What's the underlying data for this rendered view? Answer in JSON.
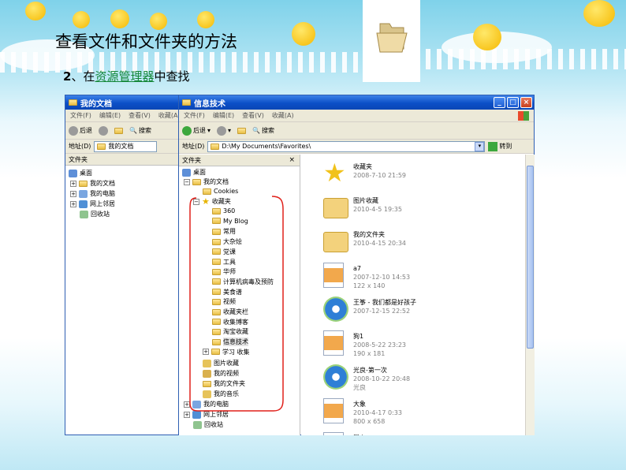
{
  "slide": {
    "title": "查看文件和文件夹的方法",
    "step_num": "2",
    "step_sep": "、在",
    "step_link": "资源管理器",
    "step_tail": "中查找"
  },
  "back_window": {
    "title": "我的文档",
    "menu": [
      "文件(F)",
      "编辑(E)",
      "查看(V)",
      "收藏(A)"
    ],
    "back_label": "后退",
    "search_label": "搜索",
    "address_label": "地址(D)",
    "address_value": "我的文档",
    "pane_header": "文件夹",
    "tree": [
      "桌面",
      "我的文档",
      "我的电脑",
      "网上邻居",
      "回收站"
    ]
  },
  "front_window": {
    "title": "信息技术",
    "menu": [
      "文件(F)",
      "编辑(E)",
      "查看(V)",
      "收藏(A)"
    ],
    "back_label": "后退",
    "search_label": "搜索",
    "address_label": "地址(D)",
    "address_value": "D:\\My Documents\\Favorites\\",
    "go_label": "转到",
    "pane_header": "文件夹",
    "pane_close": "×",
    "tree": {
      "desktop": "桌面",
      "my_docs": "我的文档",
      "cookies": "Cookies",
      "favorites": "收藏夹",
      "fav_children": [
        "360",
        "My Blog",
        "常用",
        "大杂烩",
        "党课",
        "工具",
        "华师",
        "计算机病毒及预防",
        "美食谱",
        "视频",
        "收藏夹栏",
        "收集博客",
        "淘宝收藏",
        "信息技术",
        "学习 收集"
      ],
      "pics": "图片收藏",
      "videos": "我的视频",
      "my_folder": "我的文件夹",
      "music": "我的音乐",
      "my_computer": "我的电脑",
      "network": "网上邻居",
      "recycle": "回收站"
    },
    "items": [
      {
        "name": "收藏夹",
        "meta1": "2008-7-10 21:59",
        "meta2": ""
      },
      {
        "name": "图片收藏",
        "meta1": "2010-4-5 19:35",
        "meta2": ""
      },
      {
        "name": "我的文件夹",
        "meta1": "2010-4-15 20:34",
        "meta2": ""
      },
      {
        "name": "a7",
        "meta1": "2007-12-10 14:53",
        "meta2": "122 x 140"
      },
      {
        "name": "王筝 - 我们都是好孩子",
        "meta1": "2007-12-15 22:52",
        "meta2": ""
      },
      {
        "name": "狗1",
        "meta1": "2008-5-22 23:23",
        "meta2": "190 x 181"
      },
      {
        "name": "光良-第一次",
        "meta1": "2008-10-22 20:48",
        "meta2": "光良"
      },
      {
        "name": "大象",
        "meta1": "2010-4-17 0:33",
        "meta2": "800 x 658"
      },
      {
        "name": "瀑布2",
        "meta1": "",
        "meta2": ""
      }
    ]
  },
  "colors": {
    "title_blue": "#0b4fc7",
    "highlight_red": "#e0201a",
    "link_green": "#16883a"
  }
}
